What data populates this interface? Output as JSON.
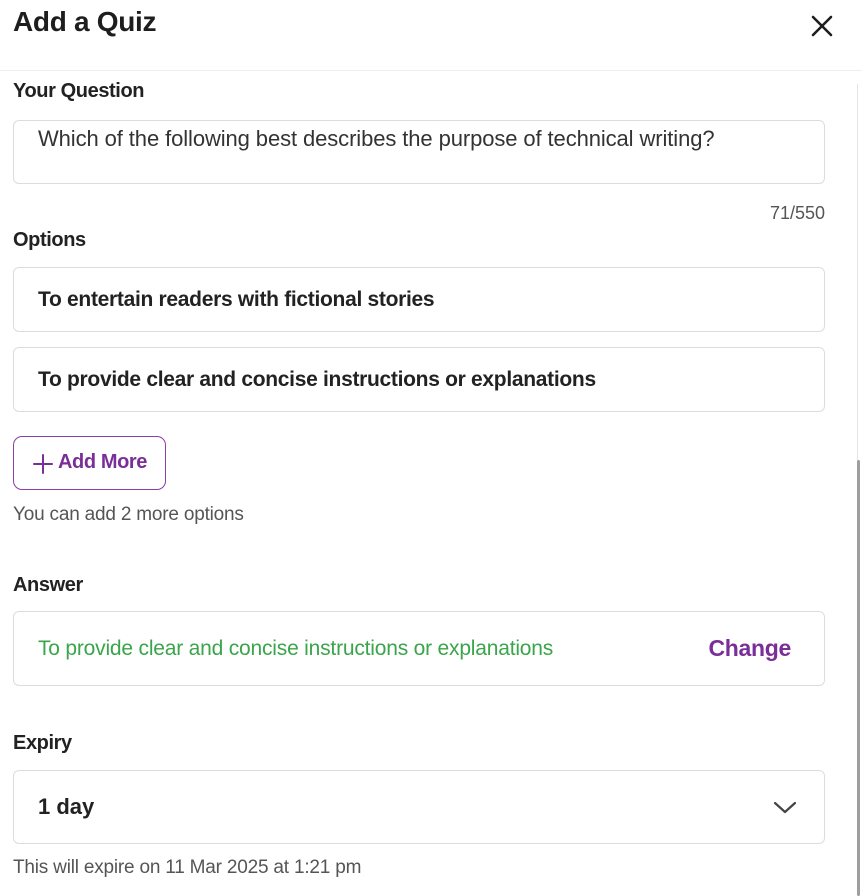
{
  "dialog": {
    "title": "Add a Quiz"
  },
  "question": {
    "label": "Your Question",
    "value": "Which of the following best describes the purpose of technical writing?",
    "counter": "71/550"
  },
  "options": {
    "label": "Options",
    "items": [
      {
        "text": "To entertain readers with fictional stories"
      },
      {
        "text": "To provide clear and concise instructions or explanations"
      }
    ],
    "add_more_label": "Add More",
    "hint": "You can add 2 more options"
  },
  "answer": {
    "label": "Answer",
    "value": "To provide clear and concise instructions or explanations",
    "change_label": "Change",
    "value_color": "#3aa54a"
  },
  "expiry": {
    "label": "Expiry",
    "selected": "1 day",
    "hint": "This will expire on 11 Mar 2025 at 1:21 pm"
  },
  "colors": {
    "accent": "#7a2f98",
    "success": "#3aa54a"
  },
  "icons": {
    "close": "close-icon",
    "add": "plus-icon",
    "dropdown": "chevron-down-icon"
  }
}
